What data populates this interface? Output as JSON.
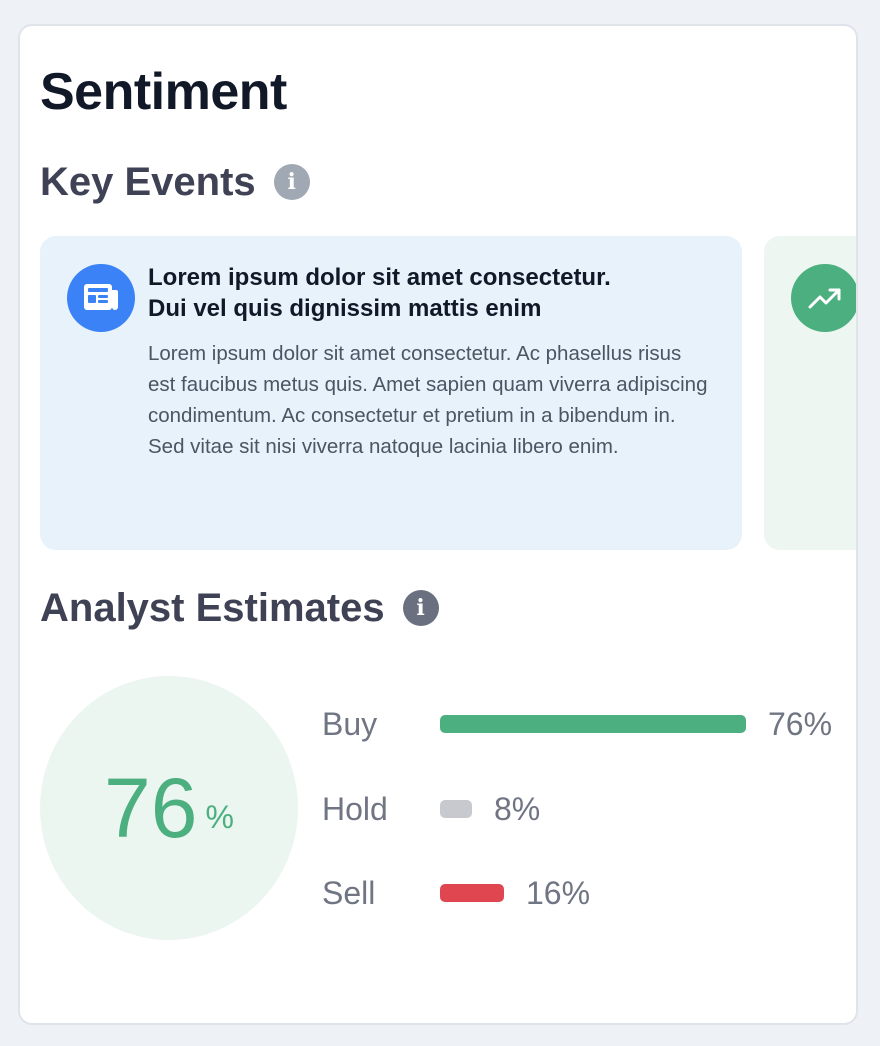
{
  "page": {
    "title": "Sentiment"
  },
  "key_events": {
    "heading": "Key Events",
    "info_icon": "info-icon",
    "cards": [
      {
        "icon": "newspaper-icon",
        "headline_line1": "Lorem ipsum dolor sit amet consectetur.",
        "headline_line2": "Dui vel quis dignissim mattis enim",
        "body": "Lorem ipsum dolor sit amet consectetur. Ac phasellus risus est faucibus metus quis. Amet sapien quam viverra adipiscing condimentum. Ac consectetur et pretium in a bibendum in. Sed vitae sit nisi viverra natoque lacinia libero enim.",
        "color": "#e8f2fb",
        "icon_color": "#3b82f6"
      },
      {
        "icon": "trending-up-icon",
        "color": "#edf6f0",
        "icon_color": "#4caf7f"
      }
    ]
  },
  "analyst_estimates": {
    "heading": "Analyst Estimates",
    "info_icon": "info-icon",
    "overall": {
      "value": "76",
      "unit": "%"
    },
    "ratings": [
      {
        "label": "Buy",
        "percent": 76,
        "display": "76%",
        "color": "#4caf7f"
      },
      {
        "label": "Hold",
        "percent": 8,
        "display": "8%",
        "color": "#c7c9cf"
      },
      {
        "label": "Sell",
        "percent": 16,
        "display": "16%",
        "color": "#e0464f"
      }
    ]
  }
}
